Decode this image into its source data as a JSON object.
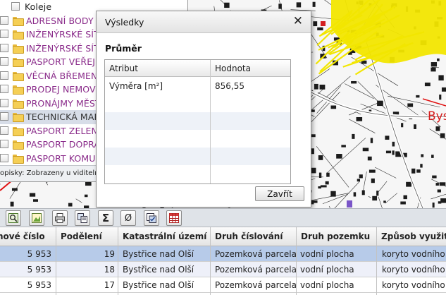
{
  "layers": [
    {
      "label": "Koleje",
      "type": "checkbox"
    },
    {
      "label": "ADRESNÍ BODY A",
      "type": "folder"
    },
    {
      "label": "INŽENÝRSKÉ SÍTĚ",
      "type": "folder"
    },
    {
      "label": "INŽENÝRSKÉ SÍTĚ",
      "type": "folder"
    },
    {
      "label": "PASPORT VEŘEJ",
      "type": "folder"
    },
    {
      "label": "VĚCNÁ BŘEMENA",
      "type": "folder"
    },
    {
      "label": "PRODEJ NEMOVIT",
      "type": "folder"
    },
    {
      "label": "PRONÁJMY MĚST",
      "type": "folder"
    },
    {
      "label": "TECHNICKÁ MAPA",
      "type": "folder",
      "selected": true
    },
    {
      "label": "PASPORT ZELEN",
      "type": "folder"
    },
    {
      "label": "PASPORT DOPRA",
      "type": "folder"
    },
    {
      "label": "PASPORT KOMUN",
      "type": "folder"
    }
  ],
  "layer_status": "opisky:  Zobrazeny u viditelný",
  "map": {
    "place_label": "Bys",
    "highlight_color": "#f2e600"
  },
  "modal": {
    "title": "Výsledky",
    "close_glyph": "✕",
    "subtitle": "Průměr",
    "table": {
      "headers": [
        "Atribut",
        "Hodnota"
      ],
      "rows": [
        {
          "attr": "Výměra [m²]",
          "value": "856,55"
        }
      ]
    },
    "close_button": "Zavřít"
  },
  "toolbar": [
    {
      "icon": "zoom-to-icon"
    },
    {
      "icon": "image-icon"
    },
    {
      "icon": "print-icon"
    },
    {
      "icon": "copy-icon"
    },
    {
      "icon": "sum-icon",
      "glyph": "Σ"
    },
    {
      "icon": "average-icon",
      "glyph": "Ø"
    },
    {
      "icon": "select-icon"
    },
    {
      "icon": "table-icon"
    }
  ],
  "grid": {
    "headers": [
      "nové číslo",
      "Podělení",
      "Katastrální území",
      "Druh číslování",
      "Druh pozemku",
      "Způsob využití"
    ],
    "rows": [
      [
        "5 953",
        "19",
        "Bystřice nad Olší",
        "Pozemková parcela",
        "vodní plocha",
        "koryto vodního to"
      ],
      [
        "5 953",
        "18",
        "Bystřice nad Olší",
        "Pozemková parcela",
        "vodní plocha",
        "koryto vodního to"
      ],
      [
        "5 953",
        "17",
        "Bystřice nad Olší",
        "Pozemková parcela",
        "vodní plocha",
        "koryto vodního to"
      ]
    ]
  }
}
